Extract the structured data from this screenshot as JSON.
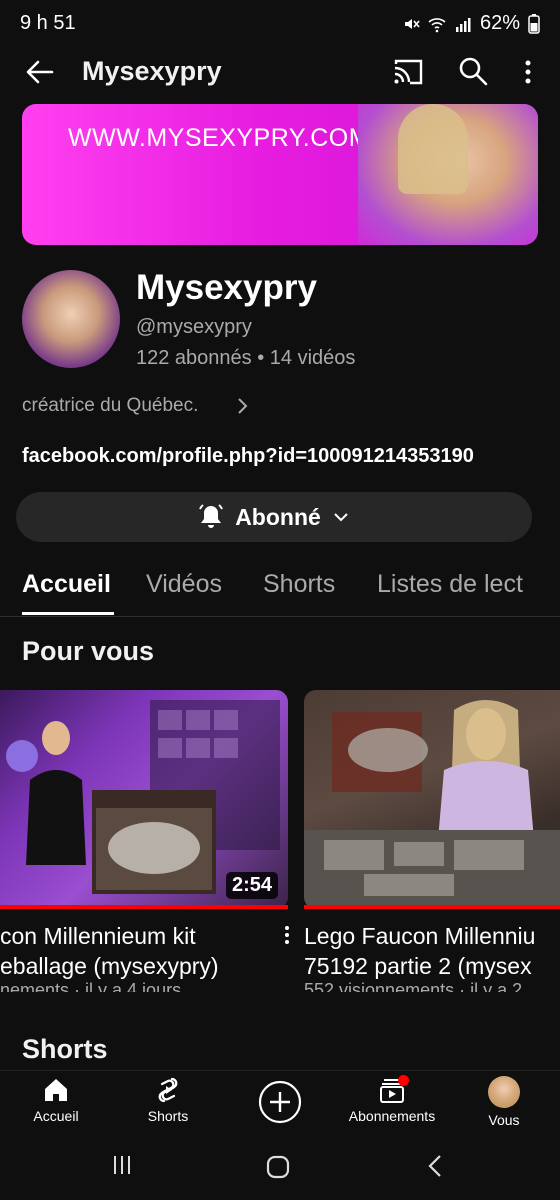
{
  "status_bar": {
    "time": "9 h 51",
    "battery": "62%",
    "icons": [
      "mute-icon",
      "wifi-icon",
      "signal-icon",
      "battery-icon"
    ]
  },
  "top_bar": {
    "title": "Mysexypry",
    "icons": [
      "back-arrow-icon",
      "cast-icon",
      "search-icon",
      "more-vertical-icon"
    ]
  },
  "banner": {
    "text": "WWW.MYSEXYPRY.COM",
    "colors": {
      "start": "#ff40f0",
      "end": "#cf13d4"
    }
  },
  "channel": {
    "name": "Mysexypry",
    "handle": "@mysexypry",
    "stats": "122 abonnés • 14 vidéos",
    "description": "créatrice du Québec.",
    "link": "facebook.com/profile.php?id=100091214353190",
    "subscribe_label": "Abonné"
  },
  "tabs": [
    {
      "label": "Accueil",
      "active": true
    },
    {
      "label": "Vidéos",
      "active": false
    },
    {
      "label": "Shorts",
      "active": false
    },
    {
      "label": "Listes de lect",
      "active": false
    }
  ],
  "sections": {
    "for_you": "Pour vous",
    "shorts": "Shorts"
  },
  "videos": [
    {
      "title_line1": "con Millennieum kit",
      "title_line2": "eballage (mysexypry)",
      "meta": "nements · il y a 4 jours",
      "duration": "2:54",
      "watched_fraction": 1.0
    },
    {
      "title_line1": "Lego Faucon Millenniu",
      "title_line2": "75192  partie 2 (mysex",
      "meta": "552 visionnements · il y a 2",
      "watched_fraction": 1.0
    }
  ],
  "bottom_nav": [
    {
      "label": "Accueil",
      "icon": "home-icon",
      "active": true
    },
    {
      "label": "Shorts",
      "icon": "shorts-icon",
      "active": false
    },
    {
      "label": "",
      "icon": "add-icon",
      "active": false
    },
    {
      "label": "Abonnements",
      "icon": "subscriptions-icon",
      "active": false,
      "notification": true
    },
    {
      "label": "Vous",
      "icon": "avatar",
      "active": false
    }
  ],
  "system_nav": [
    "recent-apps-icon",
    "home-circle-icon",
    "back-chevron-icon"
  ],
  "colors": {
    "background": "#0f0f0f",
    "surface": "#272727",
    "text_secondary": "#aaaaaa",
    "accent_red": "#ff0000"
  }
}
